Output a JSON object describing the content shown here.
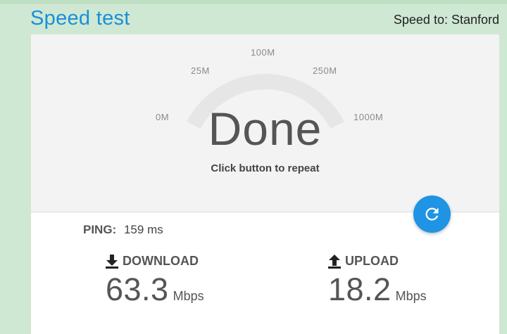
{
  "header": {
    "title": "Speed test",
    "server": "Speed to: Stanford"
  },
  "gauge": {
    "ticks": [
      "0M",
      "25M",
      "100M",
      "250M",
      "1000M"
    ],
    "status": "Done",
    "subtitle": "Click button to repeat",
    "level": 0
  },
  "ping": {
    "label": "PING:",
    "value": "159",
    "unit": "ms"
  },
  "download": {
    "label": "DOWNLOAD",
    "value": "63.3",
    "unit": "Mbps"
  },
  "upload": {
    "label": "UPLOAD",
    "value": "18.2",
    "unit": "Mbps"
  },
  "icons": {
    "repeat": "refresh-icon",
    "download": "download-arrow-icon",
    "upload": "upload-arrow-icon"
  },
  "colors": {
    "background": "#cfe8d3",
    "accent": "#1f94e4",
    "title": "#1a8fd9"
  }
}
